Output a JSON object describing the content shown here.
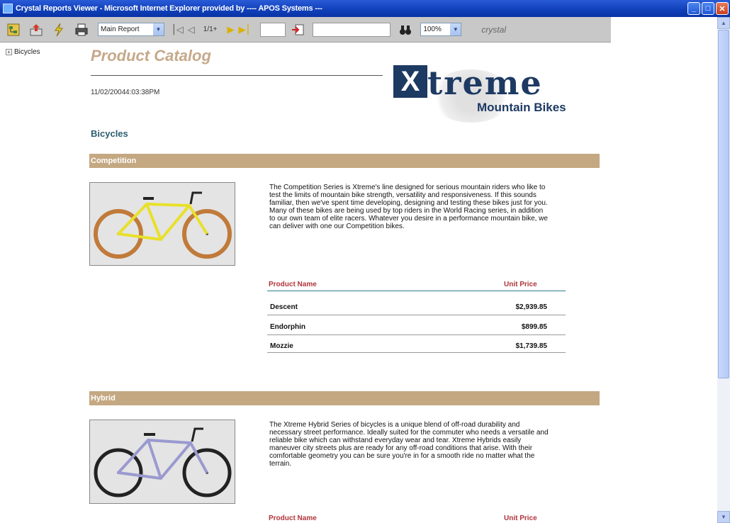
{
  "window": {
    "title": "Crystal Reports Viewer - Microsoft Internet Explorer provided by ---- APOS Systems ---",
    "controls": {
      "minimize": "_",
      "maximize": "□",
      "close": "✕"
    }
  },
  "toolbar": {
    "report_select": "Main Report",
    "page_info": "1/1+",
    "zoom": "100%",
    "brand_small": "crystal"
  },
  "tree": {
    "root": "Bicycles"
  },
  "report": {
    "title": "Product Catalog",
    "date": "11/02/2004",
    "time": "4:03:38PM",
    "brand": {
      "word": "treme",
      "box_letter": "X",
      "sub": "Mountain Bikes"
    },
    "section_title": "Bicycles",
    "columns": {
      "name": "Product Name",
      "price": "Unit Price"
    },
    "groups": [
      {
        "name": "Competition",
        "description": "The Competition Series is Xtreme's line designed for serious mountain riders who like to test the limits of mountain bike strength, versatility and responsiveness. If this sounds familiar, then we've spent time developing, designing and testing these bikes just for you. Many of these bikes are being used by top riders in the World Racing series, in addition to our own team of elite racers. Whatever you desire in a performance mountain bike, we can deliver with one our Competition bikes.",
        "frame_color": "#e8e02a",
        "rows": [
          {
            "name": "Descent",
            "price": "$2,939.85"
          },
          {
            "name": "Endorphin",
            "price": "$899.85"
          },
          {
            "name": "Mozzie",
            "price": "$1,739.85"
          }
        ]
      },
      {
        "name": "Hybrid",
        "description": "The Xtreme Hybrid Series of bicycles is a unique blend of off-road durability and necessary street performance. Ideally suited for the commuter who needs a versatile and reliable bike which can withstand everyday wear and tear. Xtreme Hybrids easily maneuver city streets plus are ready for any off-road conditions that arise. With their comfortable geometry you can be sure you're in for a smooth ride no matter what the terrain.",
        "frame_color": "#9a9ad0"
      }
    ]
  },
  "colors": {
    "band": "#c4a882",
    "header_text": "#b0343b",
    "title": "#c5a98a"
  }
}
